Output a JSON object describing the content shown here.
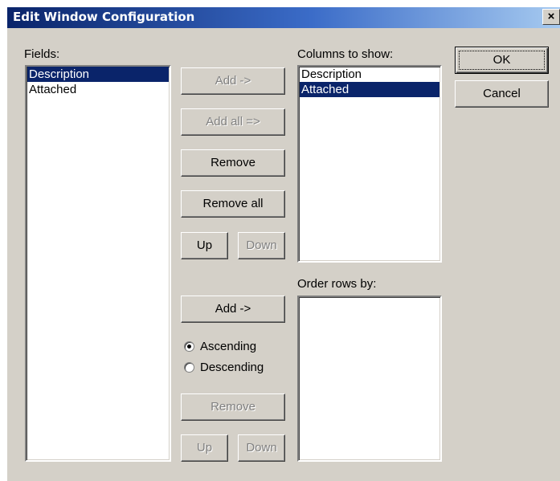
{
  "window": {
    "title": "Edit Window Configuration",
    "close_glyph": "×"
  },
  "fields": {
    "label": "Fields:",
    "items": [
      {
        "label": "Description",
        "selected": true
      },
      {
        "label": "Attached",
        "selected": false
      }
    ]
  },
  "columns": {
    "label": "Columns to show:",
    "items": [
      {
        "label": "Description",
        "selected": false
      },
      {
        "label": "Attached",
        "selected": true
      }
    ],
    "add_label": "Add ->",
    "add_all_label": "Add all =>",
    "remove_label": "Remove",
    "remove_all_label": "Remove all",
    "up_label": "Up",
    "down_label": "Down"
  },
  "order": {
    "label": "Order rows by:",
    "items": [],
    "add_label": "Add ->",
    "ascending_label": "Ascending",
    "descending_label": "Descending",
    "sort_direction": "Ascending",
    "remove_label": "Remove",
    "up_label": "Up",
    "down_label": "Down"
  },
  "dialog": {
    "ok_label": "OK",
    "cancel_label": "Cancel"
  },
  "colors": {
    "face": "#d4d0c8",
    "selection": "#0a246a",
    "title_start": "#0a246a",
    "title_end": "#a6caf0"
  }
}
